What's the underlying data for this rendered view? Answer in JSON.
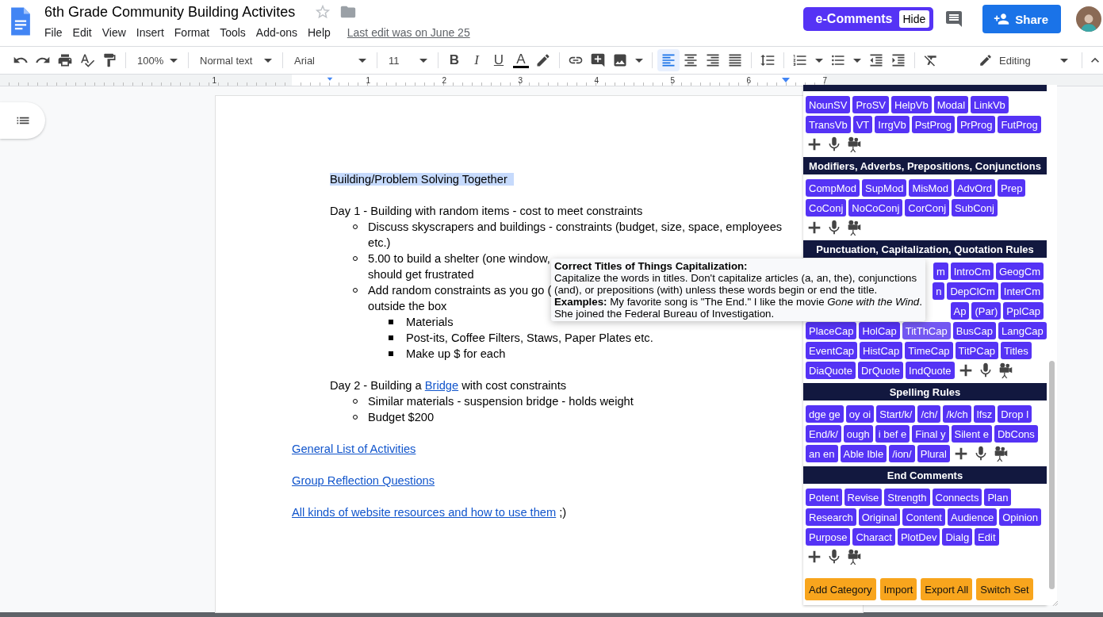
{
  "header": {
    "title": "6th Grade Community Building Activites",
    "menu": [
      "File",
      "Edit",
      "View",
      "Insert",
      "Format",
      "Tools",
      "Add-ons",
      "Help"
    ],
    "last_edit": "Last edit was on June 25",
    "ecomments": {
      "label": "e-Comments",
      "hide": "Hide"
    },
    "share": "Share"
  },
  "toolbar": {
    "zoom": "100%",
    "style": "Normal text",
    "font": "Arial",
    "font_size": "11",
    "format_buttons": [
      "B",
      "I",
      "U",
      "A"
    ],
    "alignment": [
      {
        "kind": "left",
        "selected": true
      },
      {
        "kind": "center",
        "selected": false
      },
      {
        "kind": "right",
        "selected": false
      },
      {
        "kind": "justify",
        "selected": false
      }
    ],
    "mode": "Editing"
  },
  "ruler": {
    "labels": [
      "1",
      "1",
      "2",
      "3",
      "4",
      "5",
      "6",
      "7"
    ]
  },
  "document": {
    "blocks": [
      {
        "kind": "heading",
        "text": "Building/Problem Solving Together",
        "highlighted": true
      },
      {
        "kind": "paragraph",
        "segments": [
          {
            "kind": "text",
            "text": "Day 1 - Building with random items - cost to meet constraints"
          }
        ],
        "items": [
          {
            "lines": [
              "Discuss skyscrapers and buildings - constraints (budget, size, space, employees",
              "etc.)"
            ]
          },
          {
            "lines": [
              "5.00 to build a shelter (one window,",
              "should get frustrated"
            ]
          },
          {
            "lines": [
              "Add random constraints as you go (",
              "outside the box"
            ],
            "children": [
              {
                "lines": [
                  "Materials"
                ]
              },
              {
                "lines": [
                  "Post-its, Coffee Filters, Staws, Paper Plates etc."
                ]
              },
              {
                "lines": [
                  "Make up $ for each"
                ]
              }
            ]
          }
        ]
      },
      {
        "kind": "paragraph",
        "segments": [
          {
            "kind": "text",
            "text": "Day 2 - Building a "
          },
          {
            "kind": "link",
            "text": "Bridge"
          },
          {
            "kind": "text",
            "text": " with cost constraints"
          }
        ],
        "items": [
          {
            "lines": [
              "Similar materials - suspension bridge - holds weight"
            ]
          },
          {
            "lines": [
              "Budget $200"
            ]
          }
        ]
      },
      {
        "kind": "link_line",
        "segments": [
          {
            "kind": "link",
            "text": "General List of Activities"
          }
        ]
      },
      {
        "kind": "link_line",
        "segments": [
          {
            "kind": "link",
            "text": "Group Reflection Questions"
          }
        ]
      },
      {
        "kind": "link_line",
        "segments": [
          {
            "kind": "link",
            "text": "All kinds of website resources and how to use them"
          },
          {
            "kind": "text",
            "text": " ;)"
          }
        ]
      }
    ]
  },
  "panel": {
    "categories": [
      {
        "rows": [
          {
            "covered": false,
            "items": [
              {
                "kind": "button",
                "label": "NounSV"
              },
              {
                "kind": "button",
                "label": "ProSV"
              },
              {
                "kind": "button",
                "label": "HelpVb"
              },
              {
                "kind": "button",
                "label": "Modal"
              },
              {
                "kind": "button",
                "label": "LinkVb"
              }
            ]
          },
          {
            "covered": false,
            "items": [
              {
                "kind": "button",
                "label": "TransVb"
              },
              {
                "kind": "button",
                "label": "VT"
              },
              {
                "kind": "button",
                "label": "IrrgVb"
              },
              {
                "kind": "button",
                "label": "PstProg"
              },
              {
                "kind": "button",
                "label": "PrProg"
              },
              {
                "kind": "button",
                "label": "FutProg"
              }
            ]
          },
          {
            "covered": false,
            "items": [
              {
                "kind": "tools"
              }
            ]
          }
        ]
      },
      {
        "title": "Modifiers, Adverbs, Prepositions, Conjunctions",
        "rows": [
          {
            "covered": false,
            "items": [
              {
                "kind": "button",
                "label": "CompMod"
              },
              {
                "kind": "button",
                "label": "SupMod"
              },
              {
                "kind": "button",
                "label": "MisMod"
              },
              {
                "kind": "button",
                "label": "AdvOrd"
              },
              {
                "kind": "button",
                "label": "Prep"
              }
            ]
          },
          {
            "covered": false,
            "items": [
              {
                "kind": "button",
                "label": "CoConj"
              },
              {
                "kind": "button",
                "label": "NoCoConj"
              },
              {
                "kind": "button",
                "label": "CorConj"
              },
              {
                "kind": "button",
                "label": "SubConj"
              }
            ]
          },
          {
            "covered": false,
            "items": [
              {
                "kind": "tools"
              }
            ]
          }
        ]
      },
      {
        "title": "Punctuation, Capitalization, Quotation Rules",
        "rows": [
          {
            "covered": true,
            "items": [
              {
                "kind": "button",
                "label": "m",
                "hovered": false
              },
              {
                "kind": "button",
                "label": "IntroCm",
                "hovered": false
              },
              {
                "kind": "button",
                "label": "GeogCm",
                "hovered": false
              }
            ]
          },
          {
            "covered": true,
            "items": [
              {
                "kind": "button",
                "label": "n",
                "hovered": false
              },
              {
                "kind": "button",
                "label": "DepClCm",
                "hovered": false
              },
              {
                "kind": "button",
                "label": "InterCm",
                "hovered": false
              }
            ]
          },
          {
            "covered": true,
            "items": [
              {
                "kind": "button",
                "label": "Ap",
                "hovered": false
              },
              {
                "kind": "button",
                "label": "(Par)",
                "hovered": false
              },
              {
                "kind": "button",
                "label": "PplCap",
                "hovered": false
              }
            ]
          },
          {
            "covered": false,
            "items": [
              {
                "kind": "button",
                "label": "PlaceCap",
                "hovered": false
              },
              {
                "kind": "button",
                "label": "HolCap",
                "hovered": false
              },
              {
                "kind": "button",
                "label": "TitThCap",
                "hovered": true
              },
              {
                "kind": "button",
                "label": "BusCap",
                "hovered": false
              },
              {
                "kind": "button",
                "label": "LangCap",
                "hovered": false
              }
            ]
          },
          {
            "covered": false,
            "items": [
              {
                "kind": "button",
                "label": "EventCap",
                "hovered": false
              },
              {
                "kind": "button",
                "label": "HistCap",
                "hovered": false
              },
              {
                "kind": "button",
                "label": "TimeCap",
                "hovered": false
              },
              {
                "kind": "button",
                "label": "TitPCap",
                "hovered": false
              },
              {
                "kind": "button",
                "label": "Titles",
                "hovered": false
              }
            ]
          },
          {
            "covered": false,
            "items": [
              {
                "kind": "button",
                "label": "DiaQuote",
                "hovered": false
              },
              {
                "kind": "button",
                "label": "DrQuote",
                "hovered": false
              },
              {
                "kind": "button",
                "label": "IndQuote",
                "hovered": false
              },
              {
                "kind": "tools"
              }
            ]
          }
        ]
      },
      {
        "title": "Spelling Rules",
        "rows": [
          {
            "covered": false,
            "items": [
              {
                "kind": "button",
                "label": "dge ge"
              },
              {
                "kind": "button",
                "label": "oy oi"
              },
              {
                "kind": "button",
                "label": "Start/k/"
              },
              {
                "kind": "button",
                "label": "/ch/"
              },
              {
                "kind": "button",
                "label": "/k/ch"
              },
              {
                "kind": "button",
                "label": "lfsz"
              },
              {
                "kind": "button",
                "label": "Drop l"
              }
            ]
          },
          {
            "covered": false,
            "items": [
              {
                "kind": "button",
                "label": "End/k/"
              },
              {
                "kind": "button",
                "label": "ough"
              },
              {
                "kind": "button",
                "label": "i bef e"
              },
              {
                "kind": "button",
                "label": "Final y"
              },
              {
                "kind": "button",
                "label": "Silent e"
              },
              {
                "kind": "button",
                "label": "DbCons"
              }
            ]
          },
          {
            "covered": false,
            "items": [
              {
                "kind": "button",
                "label": "an en"
              },
              {
                "kind": "button",
                "label": "Able Ible"
              },
              {
                "kind": "button",
                "label": "/ion/"
              },
              {
                "kind": "button",
                "label": "Plural"
              },
              {
                "kind": "tools"
              }
            ]
          }
        ]
      },
      {
        "title": "End Comments",
        "rows": [
          {
            "covered": false,
            "items": [
              {
                "kind": "button",
                "label": "Potent"
              },
              {
                "kind": "button",
                "label": "Revise"
              },
              {
                "kind": "button",
                "label": "Strength"
              },
              {
                "kind": "button",
                "label": "Connects"
              },
              {
                "kind": "button",
                "label": "Plan"
              }
            ]
          },
          {
            "covered": false,
            "items": [
              {
                "kind": "button",
                "label": "Research"
              },
              {
                "kind": "button",
                "label": "Original"
              },
              {
                "kind": "button",
                "label": "Content"
              },
              {
                "kind": "button",
                "label": "Audience"
              },
              {
                "kind": "button",
                "label": "Opinion"
              }
            ]
          },
          {
            "covered": false,
            "items": [
              {
                "kind": "button",
                "label": "Purpose"
              },
              {
                "kind": "button",
                "label": "Charact"
              },
              {
                "kind": "button",
                "label": "PlotDev"
              },
              {
                "kind": "button",
                "label": "Dialg"
              },
              {
                "kind": "button",
                "label": "Edit"
              }
            ]
          },
          {
            "covered": false,
            "items": [
              {
                "kind": "tools"
              }
            ]
          }
        ]
      }
    ],
    "actions": [
      "Add Category",
      "Import",
      "Export All",
      "Switch Set"
    ]
  },
  "tooltip": {
    "title": "Correct Titles of Things Capitalization:",
    "body": [
      "Capitalize the words in titles. Don't capitalize articles (a, an, the), conjunctions",
      "(and), or prepositions (with) unless these words begin or end the title."
    ],
    "examples": [
      "**Examples:** My favorite song is \"The End.\" I like the movie *Gone with the Wind*.",
      "She joined the Federal Bureau of Investigation."
    ]
  }
}
